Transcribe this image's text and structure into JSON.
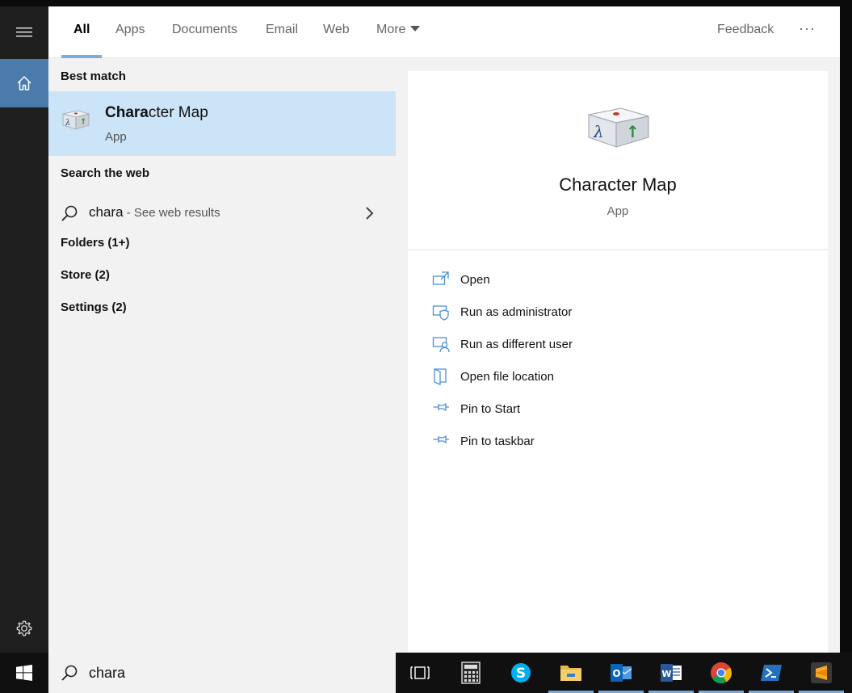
{
  "tabs": {
    "all": "All",
    "apps": "Apps",
    "documents": "Documents",
    "email": "Email",
    "web": "Web",
    "more": "More",
    "feedback": "Feedback",
    "ellipsis": "···"
  },
  "results": {
    "best_match_heading": "Best match",
    "best_match": {
      "title_bold": "Chara",
      "title_rest": "cter Map",
      "subtitle": "App"
    },
    "search_web_heading": "Search the web",
    "web_query": "chara",
    "web_hint": " - See web results",
    "categories": {
      "folders": "Folders (1+)",
      "store": "Store (2)",
      "settings": "Settings (2)"
    }
  },
  "preview": {
    "title": "Character Map",
    "subtitle": "App",
    "actions": {
      "open": "Open",
      "run_admin": "Run as administrator",
      "run_different": "Run as different user",
      "open_location": "Open file location",
      "pin_start": "Pin to Start",
      "pin_taskbar": "Pin to taskbar"
    }
  },
  "taskbar": {
    "search_value": "chara",
    "icons": [
      "task-view-icon",
      "calculator-icon",
      "skype-icon",
      "file-explorer-icon",
      "outlook-icon",
      "word-icon",
      "chrome-icon",
      "powershell-icon",
      "sublime-text-icon"
    ]
  },
  "colors": {
    "accent": "#7aaedf",
    "selected_row": "#cce4f7",
    "home_tile": "#4a7bab",
    "action_icon": "#4a90d9"
  }
}
